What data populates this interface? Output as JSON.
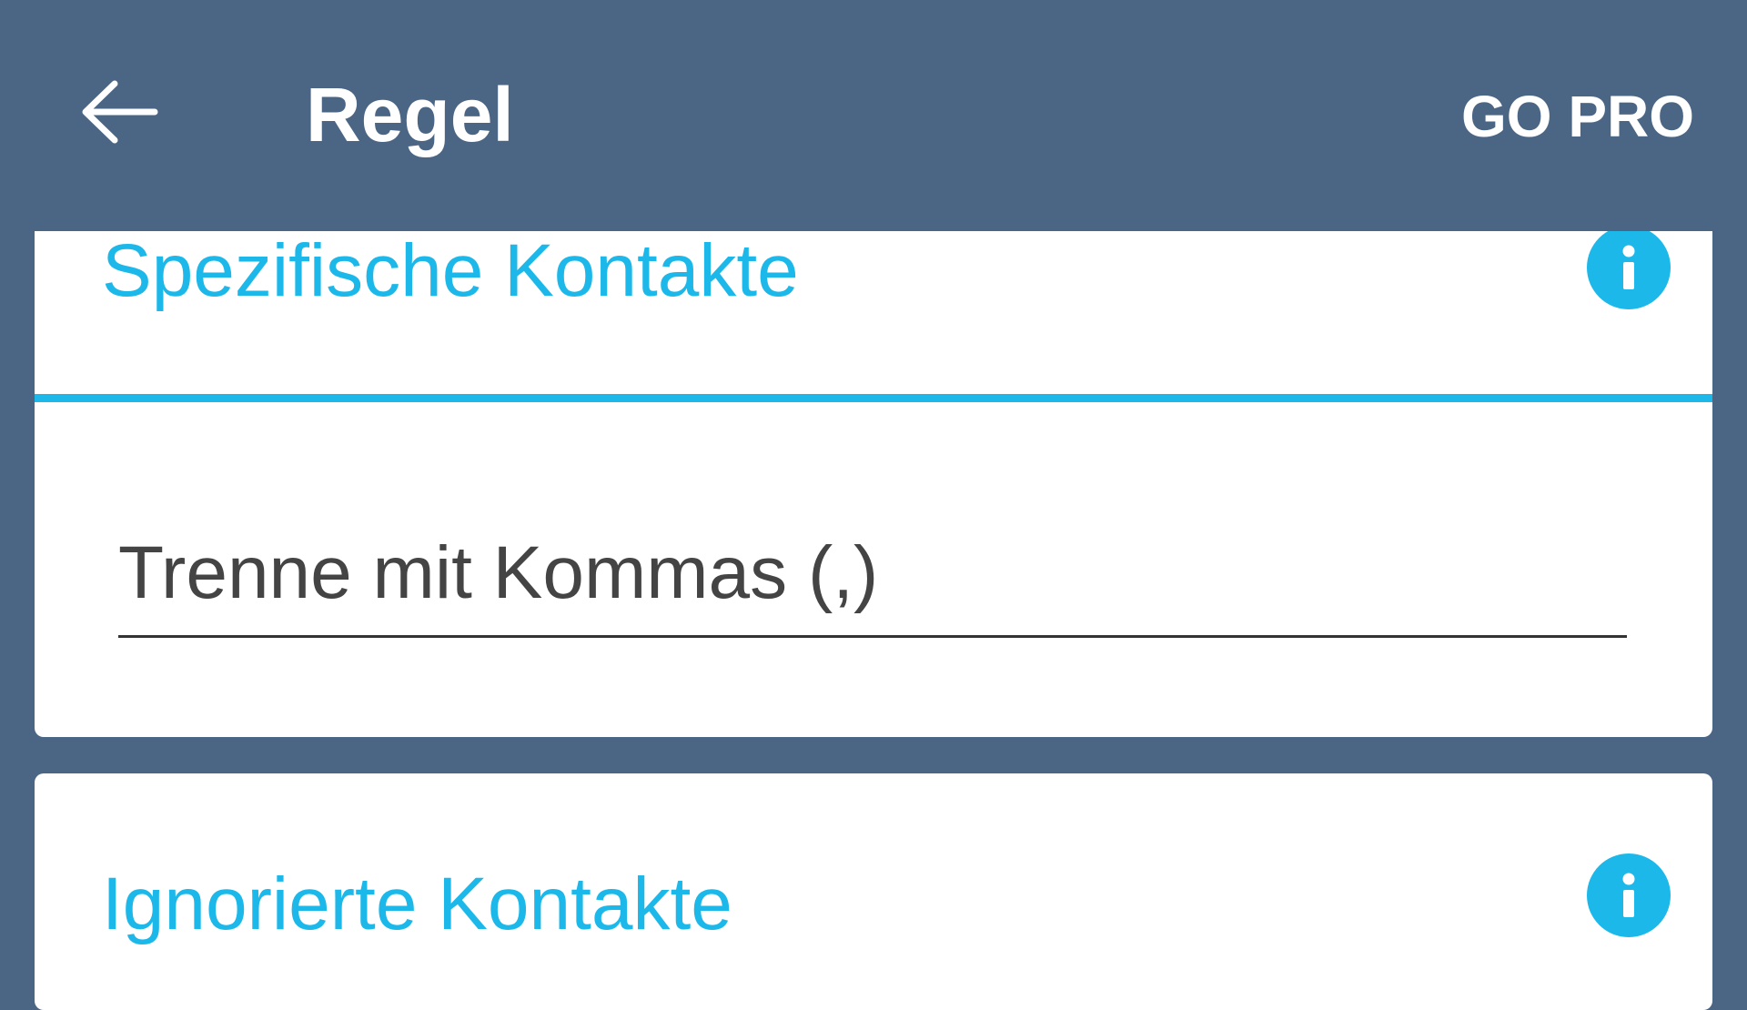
{
  "app_bar": {
    "title": "Regel",
    "action_label": "GO PRO",
    "back_icon": "arrow-left-icon"
  },
  "sections": [
    {
      "title": "Spezifische Kontakte",
      "info_icon": "info-icon",
      "input": {
        "value": "",
        "placeholder": "Trenne mit Kommas (,)"
      }
    },
    {
      "title": "Ignorierte Kontakte",
      "info_icon": "info-icon"
    }
  ],
  "colors": {
    "app_bar_bg": "#4b6584",
    "accent": "#1cb8ea",
    "card_bg": "#ffffff"
  }
}
